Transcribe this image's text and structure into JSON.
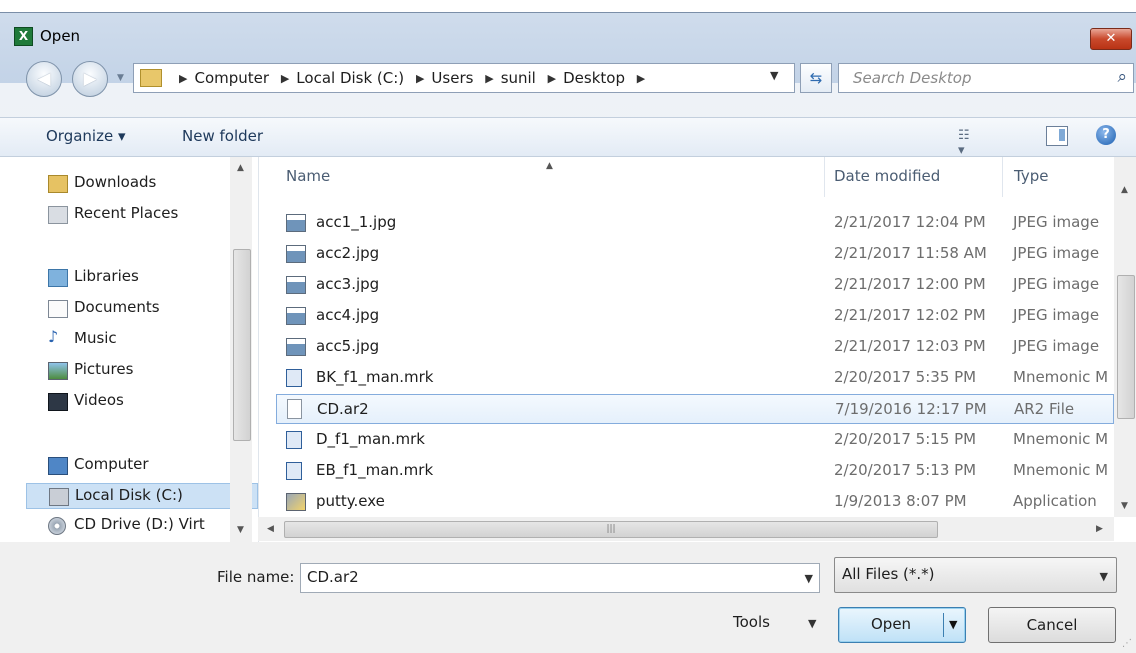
{
  "window": {
    "title": "Open",
    "close_label": "✕"
  },
  "address": {
    "crumbs": [
      "Computer",
      "Local Disk (C:)",
      "Users",
      "sunil",
      "Desktop"
    ],
    "search_placeholder": "Search Desktop"
  },
  "toolbar": {
    "organize": "Organize ▾",
    "new_folder": "New folder"
  },
  "nav": {
    "items": [
      {
        "label": "Downloads",
        "icon": "downloads-icon"
      },
      {
        "label": "Recent Places",
        "icon": "recent-places-icon"
      },
      {
        "label": "Libraries",
        "icon": "libraries-icon"
      },
      {
        "label": "Documents",
        "icon": "documents-icon"
      },
      {
        "label": "Music",
        "icon": "music-icon"
      },
      {
        "label": "Pictures",
        "icon": "pictures-icon"
      },
      {
        "label": "Videos",
        "icon": "videos-icon"
      },
      {
        "label": "Computer",
        "icon": "computer-icon"
      },
      {
        "label": "Local Disk (C:)",
        "icon": "local-disk-icon",
        "selected": true
      },
      {
        "label": "CD Drive (D:) Virt",
        "icon": "cd-drive-icon"
      }
    ]
  },
  "files": {
    "headers": {
      "name": "Name",
      "date": "Date modified",
      "type": "Type"
    },
    "rows": [
      {
        "name": "acc1_1.jpg",
        "date": "2/21/2017 12:04 PM",
        "type": "JPEG image",
        "icon": "image-file-icon"
      },
      {
        "name": "acc2.jpg",
        "date": "2/21/2017 11:58 AM",
        "type": "JPEG image",
        "icon": "image-file-icon"
      },
      {
        "name": "acc3.jpg",
        "date": "2/21/2017 12:00 PM",
        "type": "JPEG image",
        "icon": "image-file-icon"
      },
      {
        "name": "acc4.jpg",
        "date": "2/21/2017 12:02 PM",
        "type": "JPEG image",
        "icon": "image-file-icon"
      },
      {
        "name": "acc5.jpg",
        "date": "2/21/2017 12:03 PM",
        "type": "JPEG image",
        "icon": "image-file-icon"
      },
      {
        "name": "BK_f1_man.mrk",
        "date": "2/20/2017 5:35 PM",
        "type": "Mnemonic M",
        "icon": "mrk-file-icon"
      },
      {
        "name": "CD.ar2",
        "date": "7/19/2016 12:17 PM",
        "type": "AR2 File",
        "icon": "blank-file-icon",
        "selected": true
      },
      {
        "name": "D_f1_man.mrk",
        "date": "2/20/2017 5:15 PM",
        "type": "Mnemonic M",
        "icon": "mrk-file-icon"
      },
      {
        "name": "EB_f1_man.mrk",
        "date": "2/20/2017 5:13 PM",
        "type": "Mnemonic M",
        "icon": "mrk-file-icon"
      },
      {
        "name": "putty.exe",
        "date": "1/9/2013 8:07 PM",
        "type": "Application",
        "icon": "putty-app-icon"
      }
    ]
  },
  "footer": {
    "file_name_label": "File name:",
    "file_name_value": "CD.ar2",
    "filter_value": "All Files (*.*)",
    "tools_label": "Tools",
    "open_label": "Open",
    "cancel_label": "Cancel"
  }
}
